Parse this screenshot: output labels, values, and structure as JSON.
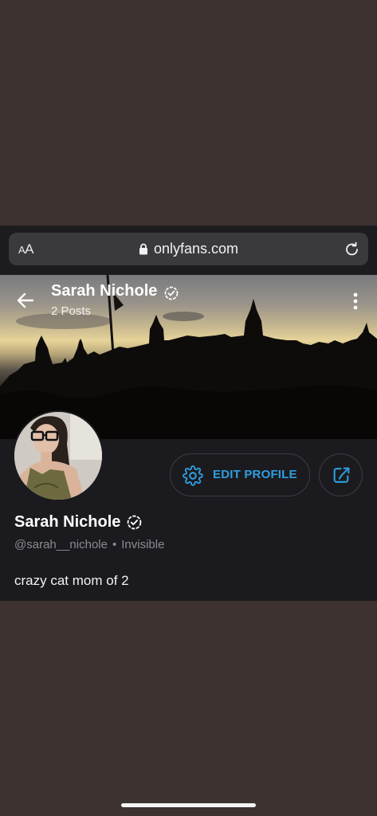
{
  "browser": {
    "aa_label_small": "A",
    "aa_label_large": "A",
    "url": "onlyfans.com"
  },
  "header": {
    "name": "Sarah Nichole",
    "posts": "2 Posts"
  },
  "profile": {
    "edit_label": "EDIT PROFILE",
    "name": "Sarah Nichole",
    "handle": "@sarah__nichole",
    "separator": "•",
    "status": "Invisible",
    "bio": "crazy cat mom of 2"
  },
  "colors": {
    "accent": "#2e9ee0",
    "page_bg": "#3d3230",
    "card_bg": "#1b1b1f"
  },
  "icons": [
    "lock-icon",
    "reload-icon",
    "back-arrow-icon",
    "verified-icon",
    "more-icon",
    "gear-icon",
    "share-icon"
  ]
}
